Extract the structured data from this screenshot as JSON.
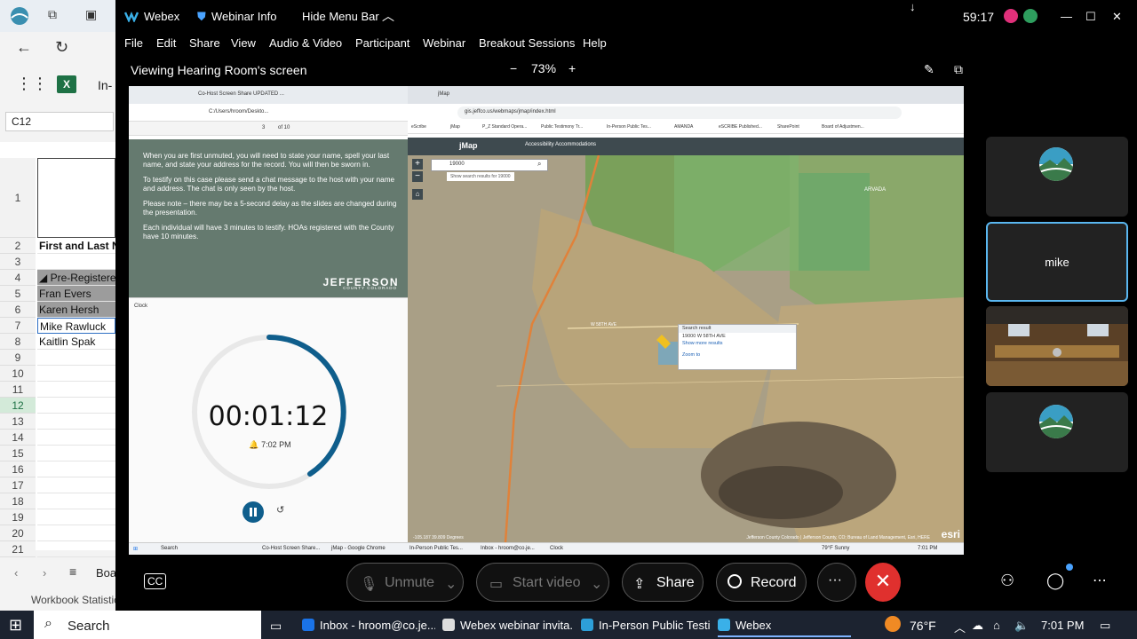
{
  "excel": {
    "app_letters": "In-",
    "name_box": "C12",
    "cell_c1": "",
    "cell_header": "First and Last Na",
    "rows": [
      {
        "n": "1",
        "text": ""
      },
      {
        "n": "2",
        "text": "First and Last Na"
      },
      {
        "n": "3",
        "text": ""
      },
      {
        "n": "4",
        "text": "◢ Pre-Registered"
      },
      {
        "n": "5",
        "text": "Fran Evers"
      },
      {
        "n": "6",
        "text": "Karen Hersh"
      },
      {
        "n": "7",
        "text": "Mike Rawluck"
      },
      {
        "n": "8",
        "text": "Kaitlin Spak"
      },
      {
        "n": "9",
        "text": ""
      },
      {
        "n": "10",
        "text": ""
      },
      {
        "n": "11",
        "text": ""
      },
      {
        "n": "12",
        "text": ""
      },
      {
        "n": "13",
        "text": ""
      },
      {
        "n": "14",
        "text": ""
      },
      {
        "n": "15",
        "text": ""
      },
      {
        "n": "16",
        "text": ""
      },
      {
        "n": "17",
        "text": ""
      },
      {
        "n": "18",
        "text": ""
      },
      {
        "n": "19",
        "text": ""
      },
      {
        "n": "20",
        "text": ""
      },
      {
        "n": "21",
        "text": ""
      }
    ],
    "sheet_tab": "Boa",
    "status": "Workbook Statistic"
  },
  "webex": {
    "title": "Webex",
    "webinar_info": "Webinar Info",
    "hide_menu": "Hide Menu Bar",
    "timer": "59:17",
    "menu": [
      "File",
      "Edit",
      "Share",
      "View",
      "Audio & Video",
      "Participant",
      "Webinar",
      "Breakout Sessions",
      "Help"
    ],
    "viewing": "Viewing Hearing Room's screen",
    "zoom_minus": "−",
    "zoom_level": "73%",
    "zoom_plus": "+",
    "participant_name": "mike",
    "controls": {
      "unmute": "Unmute",
      "start_video": "Start video",
      "share": "Share",
      "record": "Record",
      "more": "···",
      "end": "✕"
    }
  },
  "shared": {
    "pdf_tab": "Co-Host Screen Share UPDATED ...",
    "pdf_path": "C:/Users/hroom/Deskto...",
    "pdf_page": "3",
    "pdf_of": "of 10",
    "slide_p1": "When you are first unmuted, you will need to state your name, spell your last name, and state your address for the record. You will then be sworn in.",
    "slide_p2": "To testify on this case please send a chat message to the host with your name and address. The chat is only seen by the host.",
    "slide_p3": "Please note – there may be a 5-second delay as the slides are changed during the presentation.",
    "slide_p4": "Each individual will have 3 minutes to testify. HOAs registered with the County have 10 minutes.",
    "logo": "JEFFERSON",
    "logo_sub": "COUNTY COLORADO",
    "clock_title": "Clock",
    "clock_time": "00:01:12",
    "clock_alarm": "🔔 7:02 PM",
    "chrome_tab": "jMap",
    "url": "gis.jeffco.us/webmaps/jmap/index.html",
    "bookmarks": [
      "eScribe",
      "jMap",
      "P_Z Standard Opera...",
      "Public Testimony Tr...",
      "In-Person Public Tes...",
      "AMANDA",
      "eSCRIBE Published...",
      "SharePoint",
      "Board of Adjustmen..."
    ],
    "jmap_title": "jMap",
    "jmap_access": "Accessibility Accommodations",
    "search_value": "19000",
    "search_hint": "Show search results for 19000",
    "popup_title": "Search result",
    "popup_addr": "19000 W 58TH AVE",
    "popup_more": "Show more results",
    "popup_zoom": "Zoom to",
    "map_label_arvada": "ARVADA",
    "map_label_58th": "W 58TH AVE",
    "map_attrib": "Jefferson County Colorado | Jefferson County, CO; Bureau of Land Management, Esri, HERE",
    "map_coords": "-105.187 39.809 Degrees",
    "esri": "esri",
    "tb_search": "Search",
    "tb_items": [
      "Co-Host Screen Share...",
      "jMap - Google Chrome",
      "In-Person Public Tes...",
      "Inbox - hroom@co.je...",
      "Clock"
    ],
    "tb_weather": "79°F  Sunny",
    "tb_time": "7:01 PM"
  },
  "taskbar": {
    "search": "Search",
    "apps": [
      "Inbox - hroom@co.je...",
      "Webex webinar invita...",
      "In-Person Public Testi...",
      "Webex"
    ],
    "temp": "76°F",
    "time": "7:01 PM"
  },
  "colors": {
    "slide_bg": "#657a6f",
    "end_red": "#e0302e",
    "active_tile": "#5ab7f0",
    "clock_ring": "#0f5e8c"
  }
}
